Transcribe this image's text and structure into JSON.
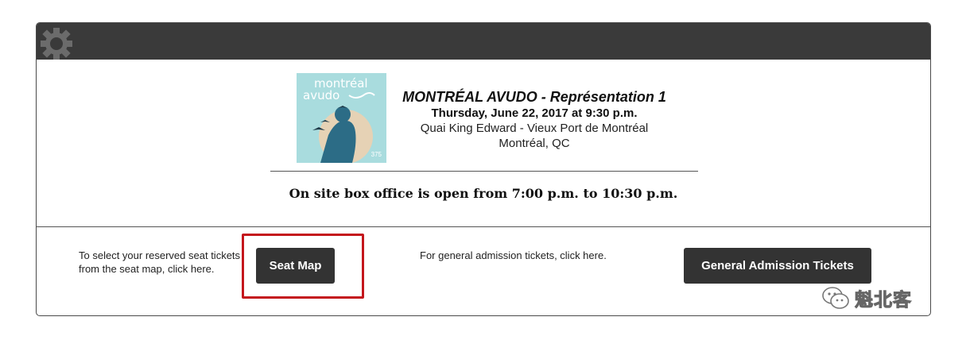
{
  "event": {
    "title": "MONTRÉAL AVUDO - Représentation 1",
    "date": "Thursday, June 22, 2017 at 9:30 p.m.",
    "venue": "Quai King Edward - Vieux Port de Montréal",
    "city": "Montréal, QC",
    "poster": {
      "line1": "montréal",
      "line2": "avudo",
      "badge": "375",
      "bg_color": "#a9dcde"
    }
  },
  "box_office": "On site box office is open from 7:00 p.m. to 10:30 p.m.",
  "reserved": {
    "text": "To select your reserved seat tickets from the seat map, click here.",
    "button": "Seat Map"
  },
  "general": {
    "text": "For general admission tickets, click here.",
    "button": "General Admission Tickets"
  },
  "watermark": {
    "text": "魁北客"
  },
  "colors": {
    "header": "#3a3a3a",
    "button": "#333333",
    "highlight": "#c4161c"
  },
  "icons": {
    "header": "gear-icon",
    "watermark": "wechat-icon"
  }
}
